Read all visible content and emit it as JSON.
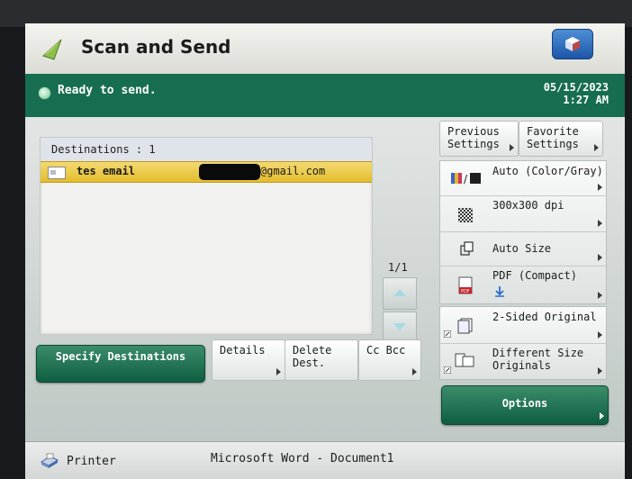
{
  "app": {
    "title": "Scan and Send"
  },
  "status": {
    "text": "Ready to send.",
    "date": "05/15/2023",
    "time": "1:27 AM"
  },
  "destinations": {
    "header": "Destinations : 1",
    "rows": [
      {
        "name": "tes email",
        "address_suffix": "@gmail.com"
      }
    ],
    "page": "1/1"
  },
  "buttons": {
    "specify": "Specify Destinations",
    "details": "Details",
    "delete": "Delete Dest.",
    "ccbcc": "Cc Bcc",
    "previous_settings": "Previous Settings",
    "favorite_settings": "Favorite Settings",
    "options": "Options"
  },
  "settings": {
    "color": "Auto (Color/Gray)",
    "resolution": "300x300 dpi",
    "size": "Auto Size",
    "format": "PDF (Compact)",
    "sided": "2-Sided Original",
    "mixed": "Different Size Originals"
  },
  "footer": {
    "printer": "Printer",
    "document": "Microsoft Word - Document1"
  },
  "colors": {
    "accent_green": "#176d4f",
    "highlight_yellow": "#e4bd2c"
  }
}
